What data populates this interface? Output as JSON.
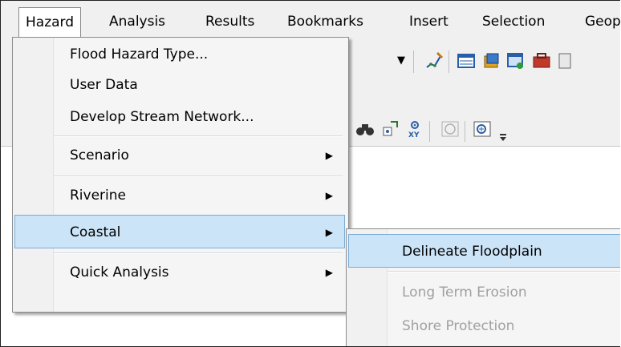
{
  "menubar": {
    "items": [
      "Hazard",
      "Analysis",
      "Results",
      "Bookmarks",
      "Insert",
      "Selection",
      "Geop"
    ]
  },
  "hazard_menu": {
    "items": [
      {
        "label": "Flood Hazard Type...",
        "submenu": false
      },
      {
        "label": "User Data",
        "submenu": false
      },
      {
        "label": "Develop Stream Network...",
        "submenu": false
      },
      {
        "label": "Scenario",
        "submenu": true
      },
      {
        "label": "Riverine",
        "submenu": true
      },
      {
        "label": "Coastal",
        "submenu": true,
        "highlighted": true
      },
      {
        "label": "Quick Analysis",
        "submenu": true
      }
    ]
  },
  "coastal_submenu": {
    "items": [
      {
        "label": "Delineate Floodplain",
        "enabled": true,
        "highlighted": true
      },
      {
        "label": "Long Term Erosion",
        "enabled": false
      },
      {
        "label": "Shore Protection",
        "enabled": false
      }
    ]
  },
  "colors": {
    "highlight_bg": "#cce4f7",
    "highlight_border": "#79abd6",
    "disabled_text": "#a0a0a0"
  },
  "icons": {
    "arrow": "▶",
    "combo_arrow": "▼"
  }
}
